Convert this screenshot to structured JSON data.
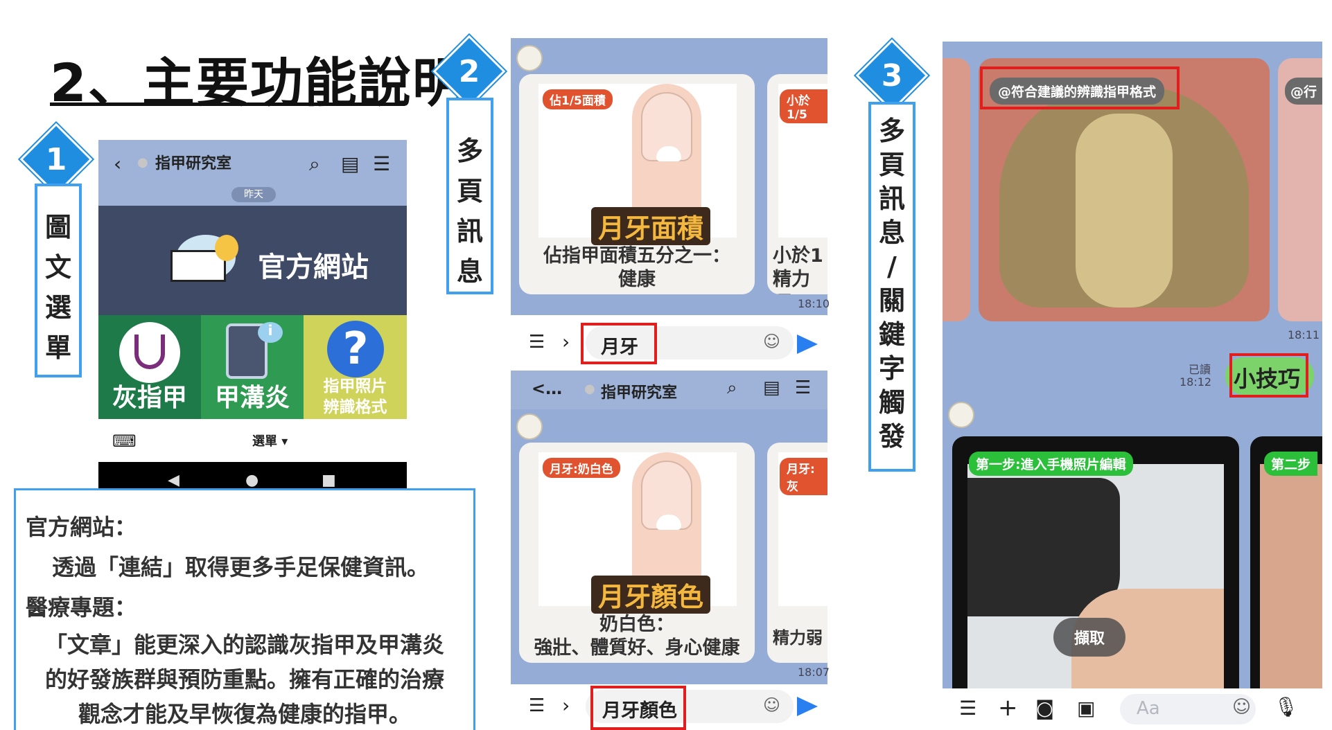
{
  "header": {
    "title": "2、主要功能說明"
  },
  "sections": [
    {
      "num": "1",
      "label": [
        "圖",
        "文",
        "選",
        "單"
      ]
    },
    {
      "num": "2",
      "label": [
        "多",
        "頁",
        "訊",
        "息"
      ]
    },
    {
      "num": "3",
      "label": [
        "多",
        "頁",
        "訊",
        "息",
        "/",
        "關",
        "鍵",
        "字",
        "觸",
        "發"
      ]
    }
  ],
  "panel1": {
    "chat_name": "指甲研究室",
    "yesterday": "昨天",
    "banner_text": "官方網站",
    "tiles": [
      {
        "label": "灰指甲",
        "color": "#1f7a4a",
        "icon": "stethoscope-icon"
      },
      {
        "label": "甲溝炎",
        "color": "#2f9a52",
        "icon": "phone-info-icon"
      },
      {
        "label_lines": [
          "指甲照片",
          "辨識格式"
        ],
        "color": "#cfd35a",
        "icon": "question-icon"
      }
    ],
    "menu_label": "選單 ▾",
    "info": {
      "h1": "官方網站：",
      "t1": "透過「連結」取得更多手足保健資訊。",
      "h2": "醫療專題：",
      "t2_lines": [
        "「文章」能更深入的認識灰指甲及甲溝炎",
        "的好發族群與預防重點。擁有正確的治療",
        "觀念才能及早恢復為健康的指甲。"
      ]
    }
  },
  "panel2": {
    "top": {
      "tag": "佔1/5面積",
      "tag_right": "小於1/5",
      "big_label": "月牙面積",
      "caption_lines": [
        "佔指甲面積五分之一：",
        "健康"
      ],
      "right_caption_lines": [
        "小於1",
        "精力不"
      ],
      "time": "18:10",
      "input": "月牙"
    },
    "bottom_header": {
      "back": "<…",
      "chat_name": "指甲研究室"
    },
    "bottom": {
      "tag": "月牙:奶白色",
      "tag_right": "月牙:灰",
      "big_label": "月牙顏色",
      "caption_lines": [
        "奶白色：",
        "強壯、體質好、身心健康"
      ],
      "right_caption": "精力弱",
      "time": "18:07",
      "input": "月牙顏色"
    }
  },
  "panel3": {
    "top_tag": "@符合建議的辨識指甲格式",
    "top_tag_right": "@行",
    "time1": "18:11",
    "read": "已讀",
    "read_time": "18:12",
    "keyword": "小技巧",
    "step1": "第一步:進入手機照片編輯",
    "step2": "第二步",
    "capture": "擷取",
    "input_placeholder": "Aa"
  },
  "colors": {
    "accent": "#1f8de0",
    "line_chat": "#95acd6",
    "highlight_red": "#e01e1e",
    "keyword_green": "#7bd36a"
  }
}
